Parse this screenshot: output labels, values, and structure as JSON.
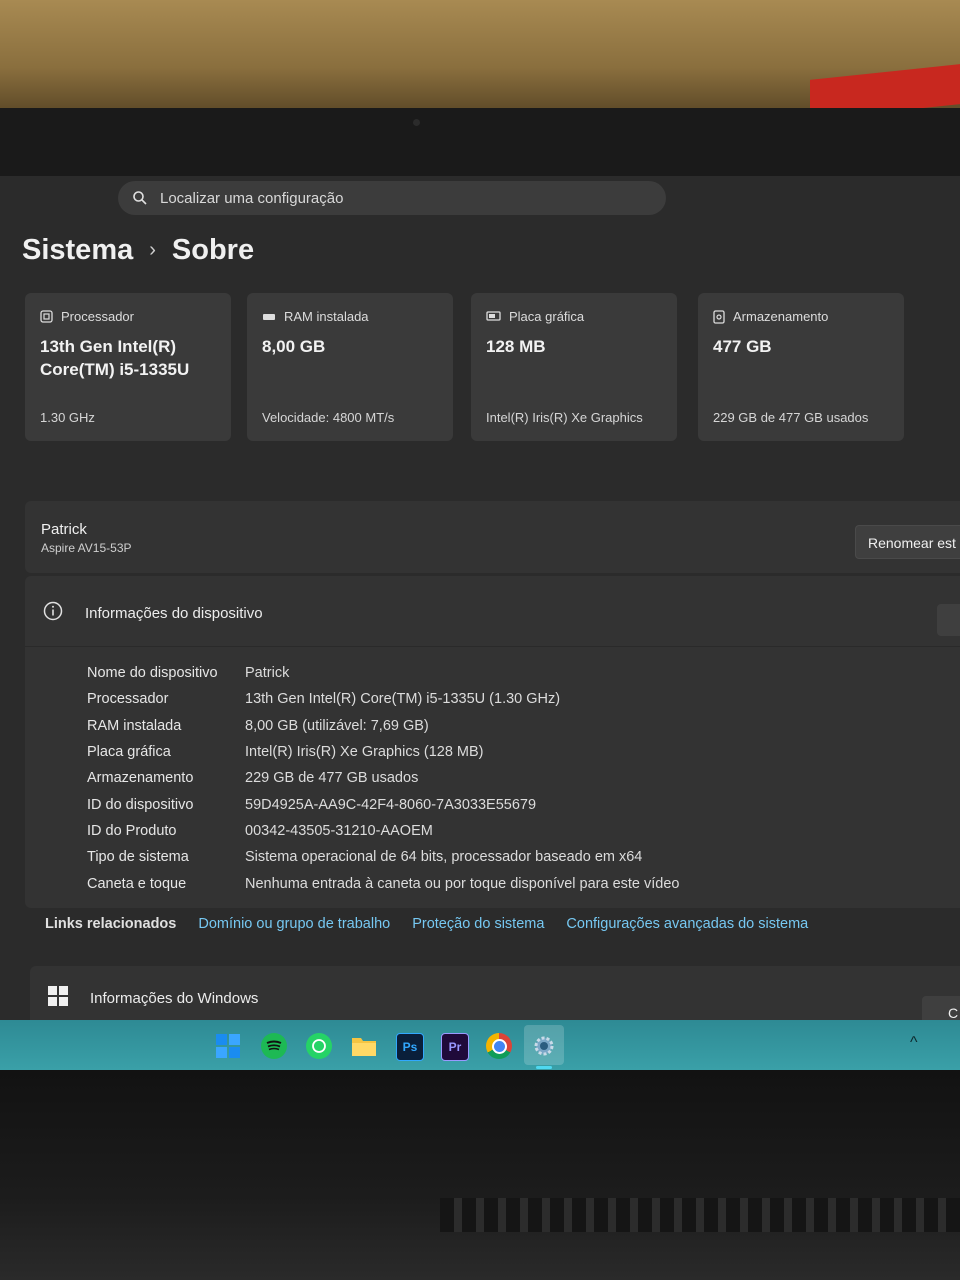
{
  "search": {
    "placeholder": "Localizar uma configuração"
  },
  "breadcrumb": {
    "parent": "Sistema",
    "separator": "›",
    "current": "Sobre"
  },
  "cards": [
    {
      "title": "Processador",
      "value": "13th Gen Intel(R) Core(TM) i5-1335U",
      "sub": "1.30 GHz",
      "icon": "processor-icon"
    },
    {
      "title": "RAM instalada",
      "value": "8,00 GB",
      "sub": "Velocidade: 4800 MT/s",
      "icon": "ram-icon"
    },
    {
      "title": "Placa gráfica",
      "value": "128 MB",
      "sub": "Intel(R) Iris(R) Xe Graphics",
      "icon": "gpu-icon"
    },
    {
      "title": "Armazenamento",
      "value": "477 GB",
      "sub": "229 GB de 477 GB usados",
      "icon": "storage-icon"
    }
  ],
  "device": {
    "name": "Patrick",
    "model": "Aspire AV15-53P",
    "rename_label": "Renomear est"
  },
  "device_info": {
    "title": "Informações do dispositivo",
    "rows": [
      {
        "label": "Nome do dispositivo",
        "value": "Patrick"
      },
      {
        "label": "Processador",
        "value": "13th Gen Intel(R) Core(TM) i5-1335U (1.30 GHz)"
      },
      {
        "label": "RAM instalada",
        "value": "8,00 GB (utilizável: 7,69 GB)"
      },
      {
        "label": "Placa gráfica",
        "value": "Intel(R) Iris(R) Xe Graphics (128 MB)"
      },
      {
        "label": "Armazenamento",
        "value": "229 GB de 477 GB usados"
      },
      {
        "label": "ID do dispositivo",
        "value": "59D4925A-AA9C-42F4-8060-7A3033E55679"
      },
      {
        "label": "ID do Produto",
        "value": "00342-43505-31210-AAOEM"
      },
      {
        "label": "Tipo de sistema",
        "value": "Sistema operacional de 64 bits, processador baseado em x64"
      },
      {
        "label": "Caneta e toque",
        "value": "Nenhuma entrada à caneta ou por toque disponível para este vídeo"
      }
    ]
  },
  "related_links": {
    "label": "Links relacionados",
    "links": [
      "Domínio ou grupo de trabalho",
      "Proteção do sistema",
      "Configurações avançadas do sistema"
    ]
  },
  "windows_info": {
    "title": "Informações do Windows",
    "button_label": "C"
  },
  "taskbar": {
    "apps": [
      {
        "name": "windows-start",
        "glyph": ""
      },
      {
        "name": "spotify",
        "glyph": ""
      },
      {
        "name": "whatsapp",
        "glyph": ""
      },
      {
        "name": "file-explorer",
        "glyph": ""
      },
      {
        "name": "photoshop",
        "glyph": "Ps"
      },
      {
        "name": "premiere",
        "glyph": "Pr"
      },
      {
        "name": "chrome",
        "glyph": ""
      },
      {
        "name": "settings",
        "glyph": ""
      }
    ],
    "tray_chevron": "^"
  },
  "colors": {
    "link": "#76c8f2",
    "panel": "#333333",
    "card": "#3a3a3a",
    "taskbar": "#3aa0a8"
  }
}
